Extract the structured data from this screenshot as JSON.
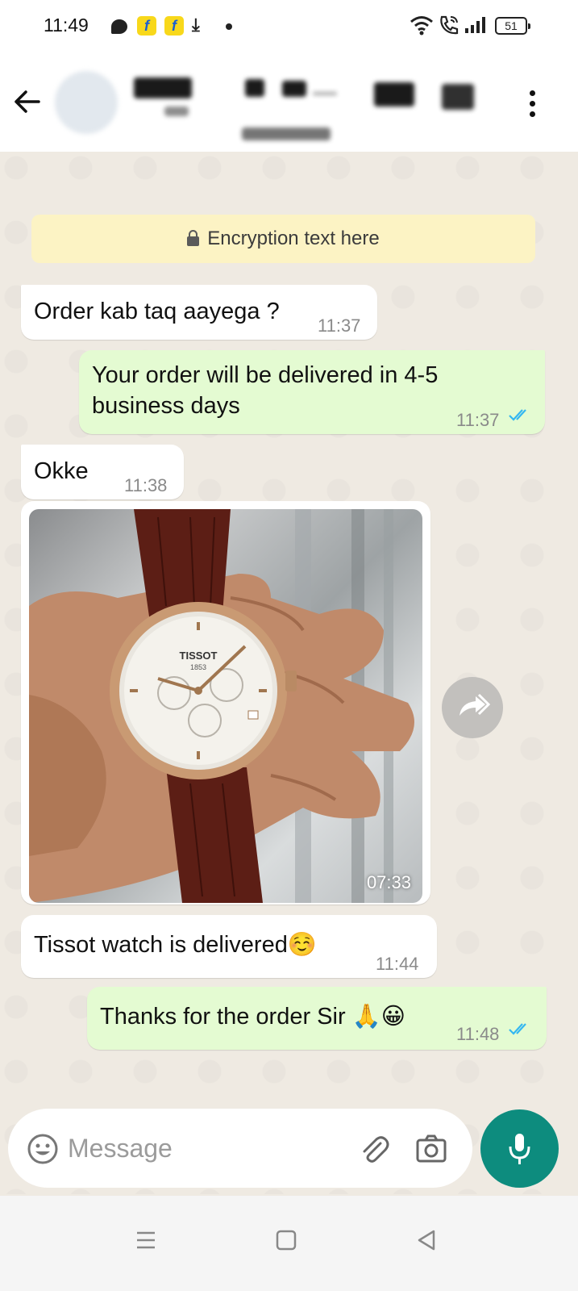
{
  "status_bar": {
    "time": "11:49",
    "battery": "51",
    "icons": [
      "chat-notification-icon",
      "flipkart-icon",
      "flipkart-icon",
      "download-icon",
      "dot-icon",
      "wifi-icon",
      "wifi-calling-icon",
      "signal-icon",
      "battery-icon"
    ]
  },
  "header": {
    "icons": [
      "back-arrow-icon",
      "more-vertical-icon"
    ]
  },
  "chat": {
    "encryption_text": "Encryption text here",
    "messages": [
      {
        "direction": "incoming",
        "text": "Order kab taq aayega ?",
        "time": "11:37"
      },
      {
        "direction": "outgoing",
        "text_line1": "Your order will be delivered in 4-5",
        "text_line2": "business days",
        "time": "11:37",
        "status": "read"
      },
      {
        "direction": "incoming",
        "text": "Okke",
        "time": "11:38"
      },
      {
        "direction": "incoming",
        "type": "image",
        "time": "07:33",
        "brand_on_dial": "TISSOT",
        "year_on_dial": "1853"
      },
      {
        "direction": "incoming",
        "text": "Tissot watch is delivered☺️",
        "time": "11:44"
      },
      {
        "direction": "outgoing",
        "text": "Thanks for the order Sir 🙏😀",
        "time": "11:48",
        "status": "read"
      }
    ]
  },
  "input": {
    "placeholder": "Message",
    "value": ""
  },
  "colors": {
    "chat_bg": "#efeae2",
    "outgoing_bubble": "#e4fbd2",
    "incoming_bubble": "#ffffff",
    "encryption_bg": "#fcf3c4",
    "mic_button": "#0d8c7e",
    "read_tick": "#34b7f1"
  }
}
